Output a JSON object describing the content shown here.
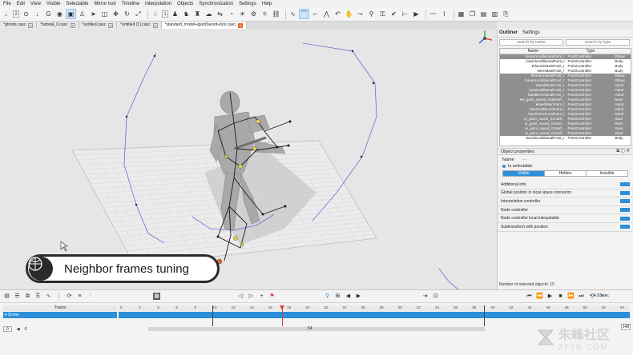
{
  "menu": [
    "File",
    "Edit",
    "View",
    "Visible",
    "Selectable",
    "Mirror tool",
    "Timeline",
    "Interpolation",
    "Objects",
    "Synchronization",
    "Settings",
    "Help"
  ],
  "toolbar": {
    "num_a": "2",
    "num_b": "1"
  },
  "file_tabs": [
    {
      "label": "*ghosts.casc",
      "active": false
    },
    {
      "label": "*tutorial_0.casc",
      "active": false
    },
    {
      "label": "*untitled.casc",
      "active": false
    },
    {
      "label": "*untitled (1).casc",
      "active": false
    },
    {
      "label": "*standard_model+giantSword+box.casc",
      "active": true
    }
  ],
  "caption": {
    "text": "Neighbor frames tuning"
  },
  "panel": {
    "tabs": [
      "Outliner",
      "Settings"
    ],
    "search_name_placeholder": "search by name",
    "search_type_placeholder": "search by type",
    "columns": [
      "Name",
      "Type"
    ],
    "rows": [
      {
        "name": "forearmAdditionalPoint_l",
        "type": "PointController",
        "body": "Elbow",
        "sel": true
      },
      {
        "name": "clavicleAdditionalPoint_l",
        "type": "PointController",
        "body": "Body",
        "sel": false
      },
      {
        "name": "▾clavicleMainPoint_r",
        "type": "PointController",
        "body": "Body",
        "sel": false
      },
      {
        "name": "▾armMainPoint_r",
        "type": "PointController",
        "body": "Body",
        "sel": false
      },
      {
        "name": "▾forearmMainPoint_r",
        "type": "PointController",
        "body": "Elbow",
        "sel": true
      },
      {
        "name": "forearmAdditionalPoint_r",
        "type": "PointController",
        "body": "Elbow",
        "sel": true
      },
      {
        "name": "▾handMainPoint_r",
        "type": "PointController",
        "body": "Hand",
        "sel": true
      },
      {
        "name": "handAdditionalPoint_r",
        "type": "PointController",
        "body": "Hand",
        "sel": true
      },
      {
        "name": "handDirectionalPoint_r",
        "type": "PointController",
        "body": "Hand",
        "sel": true
      },
      {
        "name": "▾w_giant_sword_01MainP...",
        "type": "PointController",
        "body": "Swor",
        "sel": true
      },
      {
        "name": "▾handMainPoint_l",
        "type": "PointController",
        "body": "Hand",
        "sel": true
      },
      {
        "name": "handAdditionalPoint_l",
        "type": "PointController",
        "body": "Hand",
        "sel": true
      },
      {
        "name": "handDirectionalPoint_l",
        "type": "PointController",
        "body": "Hand",
        "sel": true
      },
      {
        "name": "w_giant_sword_01Addi...",
        "type": "PointController",
        "body": "Swor",
        "sel": true
      },
      {
        "name": "w_giant_sword_01Dire...",
        "type": "PointController",
        "body": "Swor",
        "sel": true
      },
      {
        "name": "w_giant_sword_01Self...",
        "type": "PointController",
        "body": "Swor",
        "sel": true
      },
      {
        "name": "w_giant_sword_01Self...",
        "type": "PointController",
        "body": "Swor",
        "sel": true
      },
      {
        "name": "clavicleAdditionalPoint_r",
        "type": "PointController",
        "body": "Body",
        "sel": false
      }
    ],
    "object_properties": {
      "title": "Object properties",
      "name_label": "Name",
      "name_value": "---",
      "selectable_label": "Is selectable",
      "visibility": [
        "Visible",
        "Hidden",
        "Invisible"
      ],
      "sections": [
        "Additional info",
        "Global position in local space connector",
        "Interpolation controller",
        "Node controller",
        "Node controller local interpolable",
        "Subtransform with position"
      ]
    },
    "selected_count": "Number of selected objects: 15"
  },
  "timeline": {
    "speed": "4.93 sec",
    "tracks_label": "Tracks",
    "scene_label": "Scene",
    "ticks": [
      "0",
      "2",
      "4",
      "6",
      "8",
      "10",
      "12",
      "14",
      "16",
      "18",
      "20",
      "22",
      "24",
      "26",
      "28",
      "30",
      "32",
      "34",
      "36",
      "38",
      "40",
      "42",
      "44",
      "46",
      "48",
      "50",
      "52",
      "54"
    ],
    "range_start": "0",
    "range_a": "0",
    "range_end": "54",
    "frame_count": "148"
  },
  "watermark": {
    "big": "朱峰社区",
    "small": "ZF3D.COM"
  }
}
